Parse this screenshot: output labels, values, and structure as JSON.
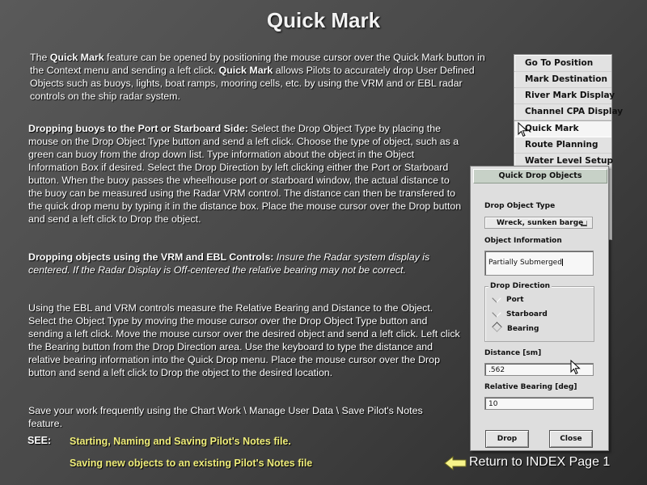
{
  "title": "Quick Mark",
  "intro": {
    "p1": "The ",
    "b1": "Quick Mark",
    "p2": " feature can be opened by positioning the mouse cursor over the Quick Mark button in the Context menu and sending a left click.  ",
    "b2": "Quick Mark",
    "p3": " allows Pilots to accurately drop User Defined Objects such as buoys, lights, boat ramps, mooring cells, etc. by using the VRM and or EBL radar controls on the ship radar system."
  },
  "section1": {
    "heading": "Dropping buoys to the Port or Starboard Side:",
    "body": "  Select the Drop Object Type by placing the mouse on the Drop Object Type button and send a left click.  Choose the type of object, such as a green can buoy from the drop down list.  Type information about the object in the Object Information Box if desired.  Select the Drop Direction by left clicking either the Port or Starboard button.  When the buoy passes the wheelhouse port or starboard window, the actual distance to the buoy can be measured using the Radar VRM control. The distance can then be transfered  to the quick drop menu by typing it in the distance box.  Place the mouse cursor over the Drop button and send a left click to Drop the object."
  },
  "section2": {
    "heading": "Dropping objects using the VRM and EBL Controls:",
    "note": " Insure the Radar system display is centered.  If  the Radar Display is Off-centered the relative bearing may not be correct."
  },
  "section3": {
    "body": "Using the EBL and VRM controls measure the Relative Bearing and Distance to the Object.  Select the Object Type by moving the mouse cursor over the Drop Object Type button and sending a left click.  Move the mouse cursor over the desired object and send a left click.  Left click the Bearing button from the Drop Direction area.  Use the keyboard to type the distance and relative bearing information into the Quick Drop menu.  Place the mouse cursor over the Drop button and send a left click to Drop the object to the desired location."
  },
  "section4": {
    "body": "Save your work frequently  using the Chart Work \\ Manage User Data \\ Save Pilot's Notes feature."
  },
  "see": {
    "label": "SEE:",
    "link1": "Starting, Naming and Saving Pilot's Notes file.",
    "link2": "Saving new objects to an existing Pilot's Notes file"
  },
  "menu": {
    "items": [
      {
        "label": "Go To Position"
      },
      {
        "label": "Mark Destination"
      },
      {
        "label": "River Mark Display"
      },
      {
        "label": "Channel CPA Display"
      },
      {
        "label": "Quick Mark"
      },
      {
        "label": "Route Planning"
      },
      {
        "label": "Water Level Setup"
      }
    ]
  },
  "dialog": {
    "title": "Quick Drop Objects",
    "drop_object_type_label": "Drop Object Type",
    "drop_object_type_value": "Wreck, sunken barge",
    "object_information_label": "Object Information",
    "object_information_value": "Partially Submerged",
    "drop_direction_label": "Drop Direction",
    "directions": [
      {
        "label": "Port",
        "selected": false
      },
      {
        "label": "Starboard",
        "selected": false
      },
      {
        "label": "Bearing",
        "selected": true
      }
    ],
    "distance_label": "Distance [sm]",
    "distance_value": ".562",
    "bearing_label": "Relative Bearing [deg]",
    "bearing_value": "10",
    "drop_button": "Drop",
    "close_button": "Close"
  },
  "footer": {
    "return_label": "Return to INDEX Page 1"
  },
  "colors": {
    "link": "#f0ee7a",
    "dialog_title_bg": "#c7d1c7",
    "arrow": "#f7f48a"
  }
}
